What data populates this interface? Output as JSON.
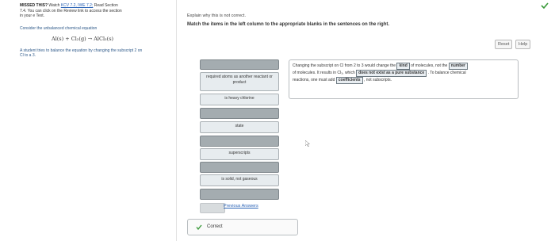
{
  "left_panel": {
    "missed_title": "MISSED THIS?",
    "watch_text": "Watch",
    "watch_link": "KCV 7.2, IWE 7.2;",
    "read_text": "Read Section",
    "section_line": "7.4. You can click on the Review link to access the section",
    "ebook": "in your e Text.",
    "consider": "Consider the unbalanced chemical equation",
    "equation": "Al(s) + Cl₂(g) → AlCl₃(s)",
    "student_note": "A student tries to balance the equation by changing the subscript 2 on Cl to a 3."
  },
  "main": {
    "explain": "Explain why this is not correct.",
    "instructions": "Match the items in the left column to the appropriate blanks in the sentences on the right.",
    "reset_label": "Reset",
    "help_label": "Help"
  },
  "tiles": [
    {
      "label": ""
    },
    {
      "label": "required atoms as another reactant or product"
    },
    {
      "label": "is heavy chlorine"
    },
    {
      "label": ""
    },
    {
      "label": "state"
    },
    {
      "label": ""
    },
    {
      "label": "superscripts"
    },
    {
      "label": ""
    },
    {
      "label": "is solid, not gaseous"
    },
    {
      "label": ""
    }
  ],
  "sentence": {
    "s1": "Changing the subscript on Cl from 2 to 3 would change the",
    "b1": "kind",
    "s2": "of molecules, not the",
    "b2": "number",
    "s3": "of molecules. It results in Cl₃, which",
    "b3": "does not exist as a pure substance",
    "s4": ". To balance chemical",
    "s5": "reactions, one must add",
    "b4": "coefficients",
    "s6": ", not subscripts."
  },
  "footer": {
    "previous_answers": "Previous Answers",
    "result": "Correct"
  },
  "colors": {
    "correct": "#3a9a3a",
    "link": "#2a63b6"
  }
}
